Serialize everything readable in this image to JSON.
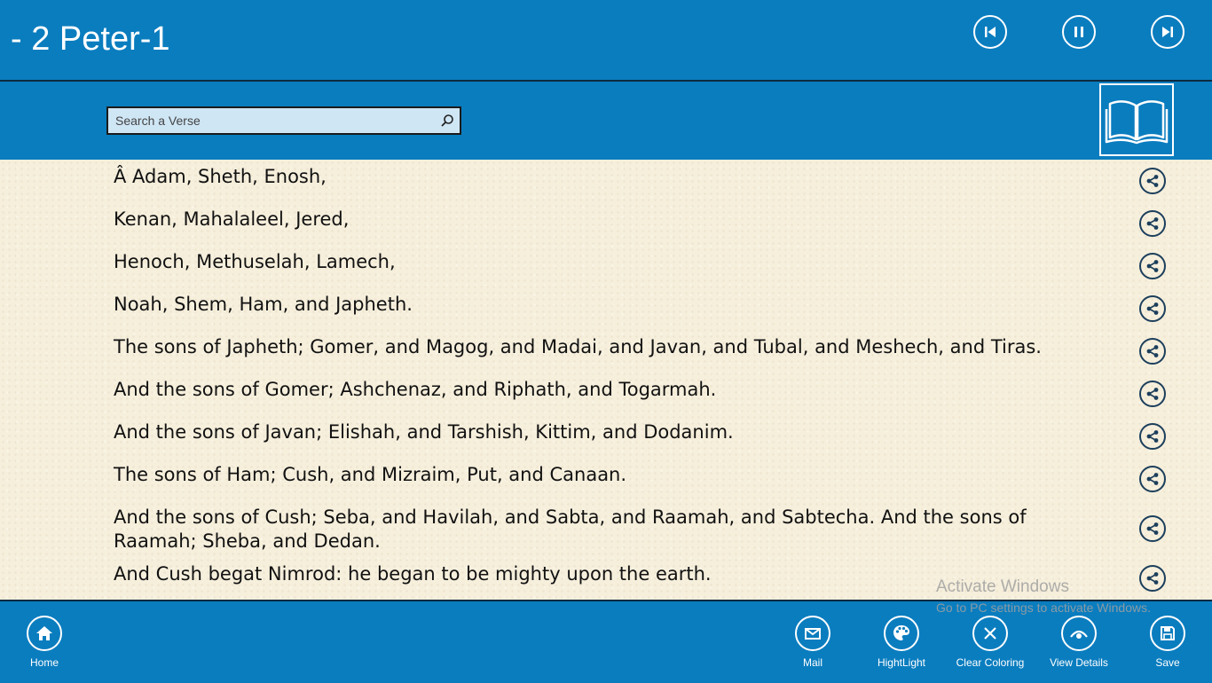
{
  "header": {
    "title": "- 2 Peter-1"
  },
  "media_controls": {
    "previous_icon": "skip-previous-icon",
    "pause_icon": "pause-icon",
    "next_icon": "skip-next-icon"
  },
  "search": {
    "placeholder": "Search a Verse",
    "icon": "search-icon"
  },
  "book_button": {
    "icon": "open-book-icon"
  },
  "verses": [
    "Â Adam, Sheth, Enosh,",
    "Kenan, Mahalaleel, Jered,",
    "Henoch, Methuselah, Lamech,",
    "Noah, Shem, Ham, and Japheth.",
    "The sons of Japheth; Gomer, and Magog, and Madai, and Javan, and Tubal, and Meshech, and Tiras.",
    "And the sons of Gomer; Ashchenaz, and Riphath, and Togarmah.",
    "And the sons of Javan; Elishah, and Tarshish, Kittim, and Dodanim.",
    "The sons of Ham; Cush, and Mizraim, Put, and Canaan.",
    "And the sons of Cush; Seba, and Havilah, and Sabta, and Raamah, and Sabtecha. And the sons of Raamah; Sheba, and Dedan.",
    "And Cush begat Nimrod: he began to be mighty upon the earth."
  ],
  "watermark": {
    "line1": "Activate Windows",
    "line2": "Go to PC settings to activate Windows."
  },
  "bottom_bar": {
    "home": {
      "label": "Home",
      "icon": "home-icon"
    },
    "mail": {
      "label": "Mail",
      "icon": "mail-icon"
    },
    "highlight": {
      "label": "HightLight",
      "icon": "palette-icon"
    },
    "clear_coloring": {
      "label": "Clear Coloring",
      "icon": "clear-icon"
    },
    "view_details": {
      "label": "View Details",
      "icon": "view-icon"
    },
    "save": {
      "label": "Save",
      "icon": "save-icon"
    }
  },
  "colors": {
    "bar": "#0a7dbf",
    "content_bg": "#f6efdc",
    "share_icon": "#1c3f5c",
    "search_bg": "#cfe6f5"
  }
}
